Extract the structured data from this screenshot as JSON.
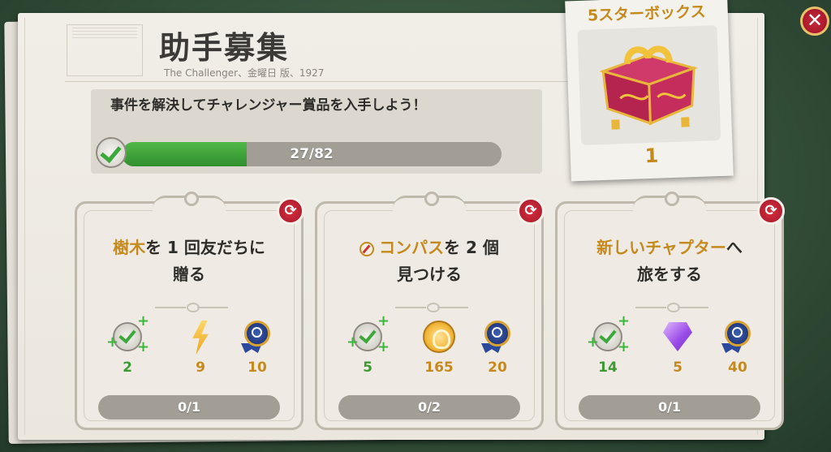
{
  "header": {
    "title": "助手募集",
    "subtitle": "The Challenger、金曜日 版、1927"
  },
  "goal": {
    "text": "事件を解決してチャレンジャー賞品を入手しよう！",
    "current": 27,
    "total": 82,
    "progress_label": "27/82"
  },
  "reward_box": {
    "title": "5スターボックス",
    "count": "1"
  },
  "tasks": [
    {
      "title_highlight": "樹木",
      "title_rest": "を 1 回友だちに",
      "title_line2": "贈る",
      "rewards": [
        {
          "icon": "green-check-plus-icon",
          "value": "2",
          "color": "#3c9a33"
        },
        {
          "icon": "lightning-bolt-icon",
          "value": "9",
          "color": "#c58a1e"
        },
        {
          "icon": "blue-medal-icon",
          "value": "10",
          "color": "#c58a1e"
        }
      ],
      "progress": "0/1"
    },
    {
      "title_highlight": "コンパス",
      "title_rest": "を 2 個",
      "title_line2": "見つける",
      "rewards": [
        {
          "icon": "green-check-plus-icon",
          "value": "5",
          "color": "#3c9a33"
        },
        {
          "icon": "gold-coin-icon",
          "value": "165",
          "color": "#c58a1e"
        },
        {
          "icon": "blue-medal-icon",
          "value": "20",
          "color": "#c58a1e"
        }
      ],
      "progress": "0/2"
    },
    {
      "title_highlight": "新しいチャプター",
      "title_rest": "へ",
      "title_line2": "旅をする",
      "rewards": [
        {
          "icon": "green-check-plus-icon",
          "value": "14",
          "color": "#3c9a33"
        },
        {
          "icon": "purple-gem-icon",
          "value": "5",
          "color": "#c58a1e"
        },
        {
          "icon": "blue-medal-icon",
          "value": "40",
          "color": "#c58a1e"
        }
      ],
      "progress": "0/1"
    }
  ]
}
